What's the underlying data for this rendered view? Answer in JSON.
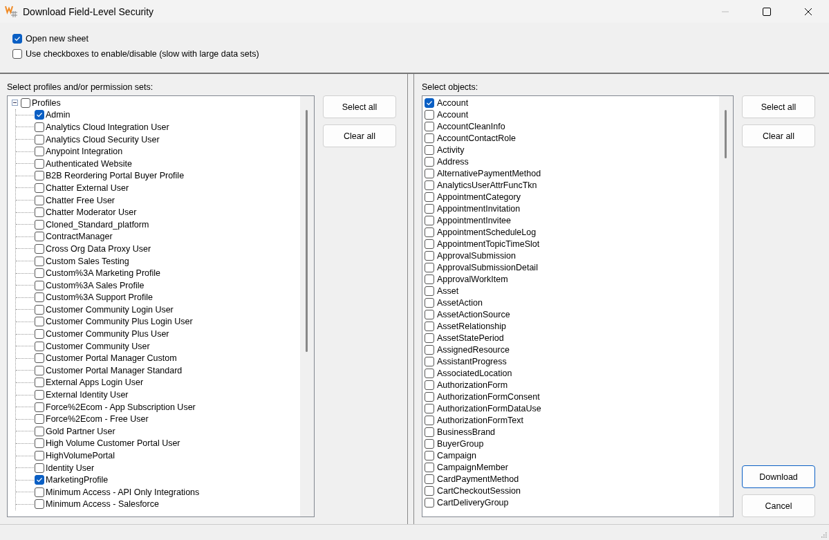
{
  "window": {
    "title": "Download Field-Level Security",
    "minimize_disabled": true
  },
  "options": [
    {
      "label": "Open new sheet",
      "checked": true
    },
    {
      "label": "Use checkboxes to enable/disable (slow with large data sets)",
      "checked": false
    }
  ],
  "profiles_panel": {
    "label": "Select profiles and/or permission sets:",
    "buttons": [
      "Select all",
      "Clear all"
    ],
    "tree": [
      {
        "label": "Profiles",
        "checked": false,
        "expanded": true,
        "children": [
          {
            "label": "Admin",
            "checked": true
          },
          {
            "label": "Analytics Cloud Integration User",
            "checked": false
          },
          {
            "label": "Analytics Cloud Security User",
            "checked": false
          },
          {
            "label": "Anypoint Integration",
            "checked": false
          },
          {
            "label": "Authenticated Website",
            "checked": false
          },
          {
            "label": "B2B Reordering Portal Buyer Profile",
            "checked": false
          },
          {
            "label": "Chatter External User",
            "checked": false
          },
          {
            "label": "Chatter Free User",
            "checked": false
          },
          {
            "label": "Chatter Moderator User",
            "checked": false
          },
          {
            "label": "Cloned_Standard_platform",
            "checked": false
          },
          {
            "label": "ContractManager",
            "checked": false
          },
          {
            "label": "Cross Org Data Proxy User",
            "checked": false
          },
          {
            "label": "Custom Sales Testing",
            "checked": false
          },
          {
            "label": "Custom%3A Marketing Profile",
            "checked": false
          },
          {
            "label": "Custom%3A Sales Profile",
            "checked": false
          },
          {
            "label": "Custom%3A Support Profile",
            "checked": false
          },
          {
            "label": "Customer Community Login User",
            "checked": false
          },
          {
            "label": "Customer Community Plus Login User",
            "checked": false
          },
          {
            "label": "Customer Community Plus User",
            "checked": false
          },
          {
            "label": "Customer Community User",
            "checked": false
          },
          {
            "label": "Customer Portal Manager Custom",
            "checked": false
          },
          {
            "label": "Customer Portal Manager Standard",
            "checked": false
          },
          {
            "label": "External Apps Login User",
            "checked": false
          },
          {
            "label": "External Identity User",
            "checked": false
          },
          {
            "label": "Force%2Ecom - App Subscription User",
            "checked": false
          },
          {
            "label": "Force%2Ecom - Free User",
            "checked": false
          },
          {
            "label": "Gold Partner User",
            "checked": false
          },
          {
            "label": "High Volume Customer Portal User",
            "checked": false
          },
          {
            "label": "HighVolumePortal",
            "checked": false
          },
          {
            "label": "Identity User",
            "checked": false
          },
          {
            "label": "MarketingProfile",
            "checked": true
          },
          {
            "label": "Minimum Access - API Only Integrations",
            "checked": false
          },
          {
            "label": "Minimum Access - Salesforce",
            "checked": false
          }
        ]
      }
    ]
  },
  "objects_panel": {
    "label": "Select objects:",
    "buttons": [
      "Select all",
      "Clear all"
    ],
    "items": [
      {
        "label": "Account",
        "checked": true
      },
      {
        "label": "Account",
        "checked": false
      },
      {
        "label": "AccountCleanInfo",
        "checked": false
      },
      {
        "label": "AccountContactRole",
        "checked": false
      },
      {
        "label": "Activity",
        "checked": false
      },
      {
        "label": "Address",
        "checked": false
      },
      {
        "label": "AlternativePaymentMethod",
        "checked": false
      },
      {
        "label": "AnalyticsUserAttrFuncTkn",
        "checked": false
      },
      {
        "label": "AppointmentCategory",
        "checked": false
      },
      {
        "label": "AppointmentInvitation",
        "checked": false
      },
      {
        "label": "AppointmentInvitee",
        "checked": false
      },
      {
        "label": "AppointmentScheduleLog",
        "checked": false
      },
      {
        "label": "AppointmentTopicTimeSlot",
        "checked": false
      },
      {
        "label": "ApprovalSubmission",
        "checked": false
      },
      {
        "label": "ApprovalSubmissionDetail",
        "checked": false
      },
      {
        "label": "ApprovalWorkItem",
        "checked": false
      },
      {
        "label": "Asset",
        "checked": false
      },
      {
        "label": "AssetAction",
        "checked": false
      },
      {
        "label": "AssetActionSource",
        "checked": false
      },
      {
        "label": "AssetRelationship",
        "checked": false
      },
      {
        "label": "AssetStatePeriod",
        "checked": false
      },
      {
        "label": "AssignedResource",
        "checked": false
      },
      {
        "label": "AssistantProgress",
        "checked": false
      },
      {
        "label": "AssociatedLocation",
        "checked": false
      },
      {
        "label": "AuthorizationForm",
        "checked": false
      },
      {
        "label": "AuthorizationFormConsent",
        "checked": false
      },
      {
        "label": "AuthorizationFormDataUse",
        "checked": false
      },
      {
        "label": "AuthorizationFormText",
        "checked": false
      },
      {
        "label": "BusinessBrand",
        "checked": false
      },
      {
        "label": "BuyerGroup",
        "checked": false
      },
      {
        "label": "Campaign",
        "checked": false
      },
      {
        "label": "CampaignMember",
        "checked": false
      },
      {
        "label": "CardPaymentMethod",
        "checked": false
      },
      {
        "label": "CartCheckoutSession",
        "checked": false
      },
      {
        "label": "CartDeliveryGroup",
        "checked": false
      }
    ]
  },
  "footer_buttons": [
    {
      "label": "Download",
      "kind": "default"
    },
    {
      "label": "Cancel",
      "kind": "normal"
    }
  ]
}
